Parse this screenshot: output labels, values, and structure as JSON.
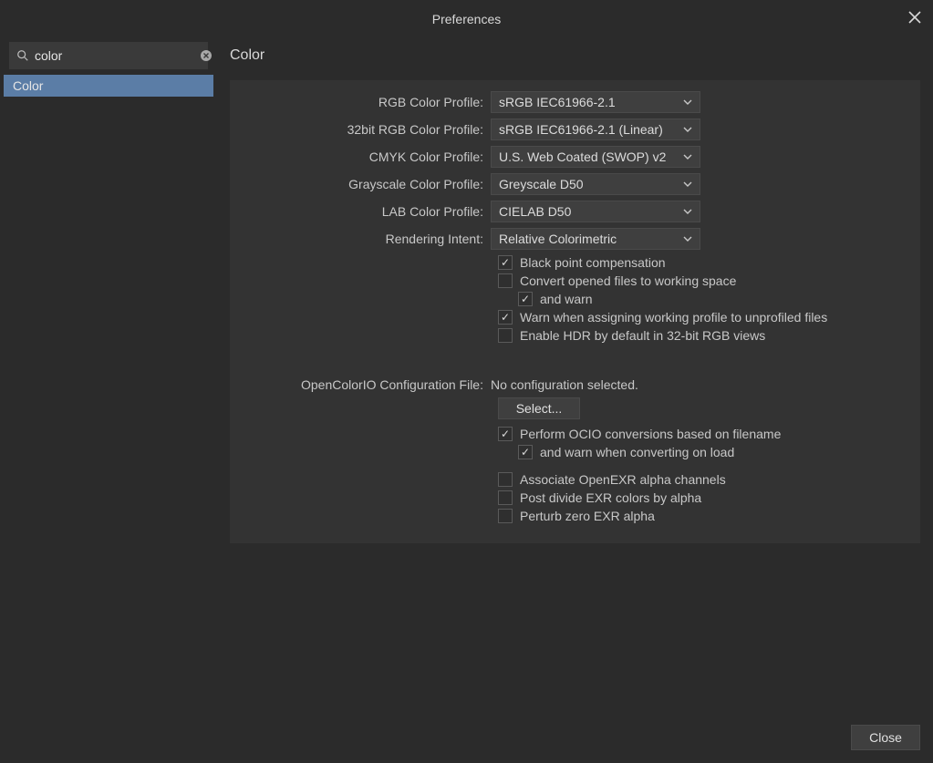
{
  "titlebar": {
    "title": "Preferences"
  },
  "sidebar": {
    "search_value": "color",
    "items": [
      {
        "label": "Color",
        "selected": true
      }
    ]
  },
  "page": {
    "title": "Color",
    "rgb_profile": {
      "label": "RGB Color Profile:",
      "value": "sRGB IEC61966-2.1"
    },
    "rgb32_profile": {
      "label": "32bit RGB Color Profile:",
      "value": "sRGB IEC61966-2.1 (Linear)"
    },
    "cmyk_profile": {
      "label": "CMYK Color Profile:",
      "value": "U.S. Web Coated (SWOP) v2"
    },
    "gray_profile": {
      "label": "Grayscale Color Profile:",
      "value": "Greyscale D50"
    },
    "lab_profile": {
      "label": "LAB Color Profile:",
      "value": "CIELAB D50"
    },
    "rendering_intent": {
      "label": "Rendering Intent:",
      "value": "Relative Colorimetric"
    },
    "blackpoint": {
      "label": "Black point compensation",
      "checked": true
    },
    "convert_ws": {
      "label": "Convert opened files to working space",
      "checked": false
    },
    "convert_ws_warn": {
      "label": "and warn",
      "checked": true
    },
    "warn_assign": {
      "label": "Warn when assigning working profile to unprofiled files",
      "checked": true
    },
    "enable_hdr": {
      "label": "Enable HDR by default in 32-bit RGB views",
      "checked": false
    },
    "ocio_label": "OpenColorIO Configuration File:",
    "ocio_value": "No configuration selected.",
    "ocio_select_btn": "Select...",
    "ocio_filename": {
      "label": "Perform OCIO conversions based on filename",
      "checked": true
    },
    "ocio_filename_warn": {
      "label": "and warn when converting on load",
      "checked": true
    },
    "exr_alpha": {
      "label": "Associate OpenEXR alpha channels",
      "checked": false
    },
    "exr_post_divide": {
      "label": "Post divide EXR colors by alpha",
      "checked": false
    },
    "exr_perturb": {
      "label": "Perturb zero EXR alpha",
      "checked": false
    }
  },
  "footer": {
    "close": "Close"
  }
}
